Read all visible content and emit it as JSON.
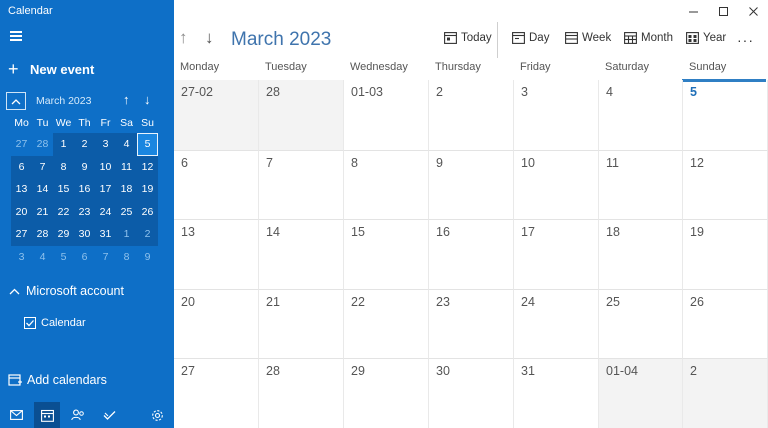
{
  "app": {
    "title": "Calendar"
  },
  "sidebar": {
    "new_event": "New event",
    "mini_calendar": {
      "month_label": "March 2023",
      "weekdays": [
        "Mo",
        "Tu",
        "We",
        "Th",
        "Fr",
        "Sa",
        "Su"
      ],
      "weeks": [
        [
          {
            "d": "27",
            "cur": false
          },
          {
            "d": "28",
            "cur": false
          },
          {
            "d": "1",
            "cur": true
          },
          {
            "d": "2",
            "cur": true
          },
          {
            "d": "3",
            "cur": true
          },
          {
            "d": "4",
            "cur": true
          },
          {
            "d": "5",
            "cur": true,
            "today": true
          }
        ],
        [
          {
            "d": "6",
            "cur": true
          },
          {
            "d": "7",
            "cur": true
          },
          {
            "d": "8",
            "cur": true
          },
          {
            "d": "9",
            "cur": true
          },
          {
            "d": "10",
            "cur": true
          },
          {
            "d": "11",
            "cur": true
          },
          {
            "d": "12",
            "cur": true
          }
        ],
        [
          {
            "d": "13",
            "cur": true
          },
          {
            "d": "14",
            "cur": true
          },
          {
            "d": "15",
            "cur": true
          },
          {
            "d": "16",
            "cur": true
          },
          {
            "d": "17",
            "cur": true
          },
          {
            "d": "18",
            "cur": true
          },
          {
            "d": "19",
            "cur": true
          }
        ],
        [
          {
            "d": "20",
            "cur": true
          },
          {
            "d": "21",
            "cur": true
          },
          {
            "d": "22",
            "cur": true
          },
          {
            "d": "23",
            "cur": true
          },
          {
            "d": "24",
            "cur": true
          },
          {
            "d": "25",
            "cur": true
          },
          {
            "d": "26",
            "cur": true
          }
        ],
        [
          {
            "d": "27",
            "cur": true
          },
          {
            "d": "28",
            "cur": true
          },
          {
            "d": "29",
            "cur": true
          },
          {
            "d": "30",
            "cur": true
          },
          {
            "d": "31",
            "cur": true
          },
          {
            "d": "1",
            "cur": false,
            "tinted": true
          },
          {
            "d": "2",
            "cur": false,
            "tinted": true
          }
        ],
        [
          {
            "d": "3",
            "cur": false
          },
          {
            "d": "4",
            "cur": false
          },
          {
            "d": "5",
            "cur": false
          },
          {
            "d": "6",
            "cur": false
          },
          {
            "d": "7",
            "cur": false
          },
          {
            "d": "8",
            "cur": false
          },
          {
            "d": "9",
            "cur": false
          }
        ]
      ]
    },
    "account": "Microsoft account",
    "calendar_item": "Calendar",
    "add_calendars": "Add calendars",
    "bottom_nav": [
      "mail-icon",
      "calendar-icon",
      "people-icon",
      "todo-icon",
      "settings-icon"
    ]
  },
  "header": {
    "title": "March 2023",
    "toolbar": {
      "today": "Today",
      "day": "Day",
      "week": "Week",
      "month": "Month",
      "year": "Year"
    }
  },
  "month_view": {
    "weekdays": [
      "Monday",
      "Tuesday",
      "Wednesday",
      "Thursday",
      "Friday",
      "Saturday",
      "Sunday"
    ],
    "weeks": [
      [
        {
          "d": "27-02",
          "grey": true
        },
        {
          "d": "28",
          "grey": true
        },
        {
          "d": "01-03"
        },
        {
          "d": "2"
        },
        {
          "d": "3"
        },
        {
          "d": "4"
        },
        {
          "d": "5",
          "today": true
        }
      ],
      [
        {
          "d": "6"
        },
        {
          "d": "7"
        },
        {
          "d": "8"
        },
        {
          "d": "9"
        },
        {
          "d": "10"
        },
        {
          "d": "11"
        },
        {
          "d": "12"
        }
      ],
      [
        {
          "d": "13"
        },
        {
          "d": "14"
        },
        {
          "d": "15"
        },
        {
          "d": "16"
        },
        {
          "d": "17"
        },
        {
          "d": "18"
        },
        {
          "d": "19"
        }
      ],
      [
        {
          "d": "20"
        },
        {
          "d": "21"
        },
        {
          "d": "22"
        },
        {
          "d": "23"
        },
        {
          "d": "24"
        },
        {
          "d": "25"
        },
        {
          "d": "26"
        }
      ],
      [
        {
          "d": "27"
        },
        {
          "d": "28"
        },
        {
          "d": "29"
        },
        {
          "d": "30"
        },
        {
          "d": "31"
        },
        {
          "d": "01-04",
          "grey": true
        },
        {
          "d": "2",
          "grey": true
        }
      ]
    ]
  },
  "colors": {
    "sidebar": "#0e6fc7",
    "accent": "#2f7fc4",
    "title": "#3f74ad"
  }
}
